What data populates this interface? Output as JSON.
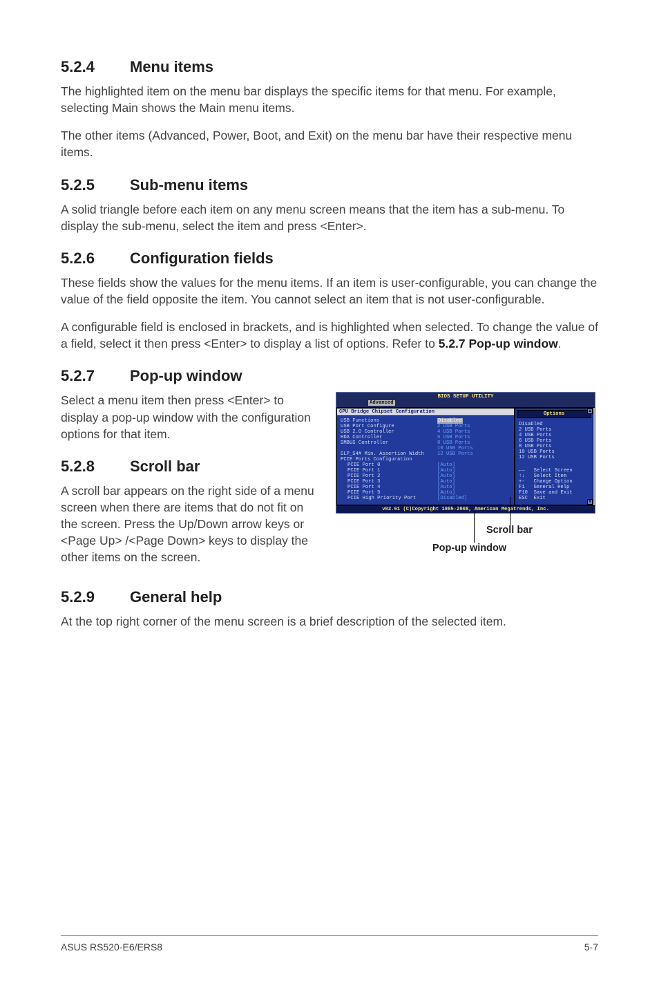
{
  "sections": {
    "s524": {
      "num": "5.2.4",
      "title": "Menu items"
    },
    "s525": {
      "num": "5.2.5",
      "title": "Sub-menu items"
    },
    "s526": {
      "num": "5.2.6",
      "title": "Configuration fields"
    },
    "s527": {
      "num": "5.2.7",
      "title": "Pop-up window"
    },
    "s528": {
      "num": "5.2.8",
      "title": "Scroll bar"
    },
    "s529": {
      "num": "5.2.9",
      "title": "General help"
    }
  },
  "paragraphs": {
    "p524a": "The highlighted item on the menu bar  displays the specific items for that menu. For example, selecting Main shows the Main menu items.",
    "p524b": "The other items (Advanced, Power, Boot, and Exit) on the menu bar have their respective menu items.",
    "p525": "A solid triangle before each item on any menu screen means that the item has a sub-menu. To display the sub-menu, select the item and press <Enter>.",
    "p526a": "These fields show the values for the menu items. If an item is user-configurable, you can change the value of the field opposite the item. You cannot select an item that is not user-configurable.",
    "p526b_pre": "A configurable field is enclosed in brackets, and is highlighted when selected. To change the value of a field, select it then press <Enter> to display a list of options. Refer to ",
    "p526b_ref": "5.2.7 Pop-up window",
    "p526b_post": ".",
    "p527": "Select a menu item then press <Enter> to display a pop-up window with the configuration options for that item.",
    "p528": "A scroll bar appears on the right side of a menu screen when there are items that do not fit on the screen. Press the Up/Down arrow keys or <Page Up> /<Page Down> keys to display the other items on the screen.",
    "p529": "At the top right corner of the menu screen is a brief description of the selected item."
  },
  "callouts": {
    "scrollbar": "Scroll bar",
    "popup": "Pop-up window"
  },
  "bios": {
    "title": "BIOS SETUP UTILITY",
    "tab": "Advanced",
    "panel_title": "CPU Bridge Chipset Configuration",
    "left_rows": [
      {
        "lbl": "USB Functions",
        "val": "Disabled",
        "hl": true
      },
      {
        "lbl": "USB Port Configure",
        "val": "2 USB Ports"
      },
      {
        "lbl": "USB 2.0 Controller",
        "val": "4 USB Ports"
      },
      {
        "lbl": "HDA Controller",
        "val": "6 USB Ports"
      },
      {
        "lbl": "SMBUS Controller",
        "val": "8 USB Ports"
      },
      {
        "lbl": "",
        "val": "10 USB Ports"
      },
      {
        "lbl": "SLP_S4# Min. Assertion Width",
        "val": "12 USB Ports"
      },
      {
        "lbl": "",
        "val": ""
      },
      {
        "lbl": "PCIE Ports Configuration",
        "val": ""
      },
      {
        "lbl": "PCIE Port 0",
        "val": "[Auto]",
        "sub": true
      },
      {
        "lbl": "PCIE Port 1",
        "val": "[Auto]",
        "sub": true
      },
      {
        "lbl": "PCIE Port 2",
        "val": "[Auto]",
        "sub": true
      },
      {
        "lbl": "PCIE Port 3",
        "val": "[Auto]",
        "sub": true
      },
      {
        "lbl": "PCIE Port 4",
        "val": "[Auto]",
        "sub": true
      },
      {
        "lbl": "PCIE Port 5",
        "val": "[Auto]",
        "sub": true
      },
      {
        "lbl": "PCIE High Priority Port",
        "val": "[Disabled]",
        "sub": true
      }
    ],
    "right_header": "Options",
    "right_options": [
      "Disabled",
      "2 USB Ports",
      "4 USB Ports",
      "6 USB Ports",
      "8 USB Ports",
      "10 USB Ports",
      "12 USB Ports"
    ],
    "help_rows": [
      "←→   Select Screen",
      "↑↓   Select Item",
      "+-   Change Option",
      "F1   General Help",
      "F10  Save and Exit",
      "ESC  Exit"
    ],
    "footer": "v02.61 (C)Copyright 1985-2008, American Megatrends, Inc."
  },
  "footer": {
    "left": "ASUS RS520-E6/ERS8",
    "right": "5-7"
  }
}
